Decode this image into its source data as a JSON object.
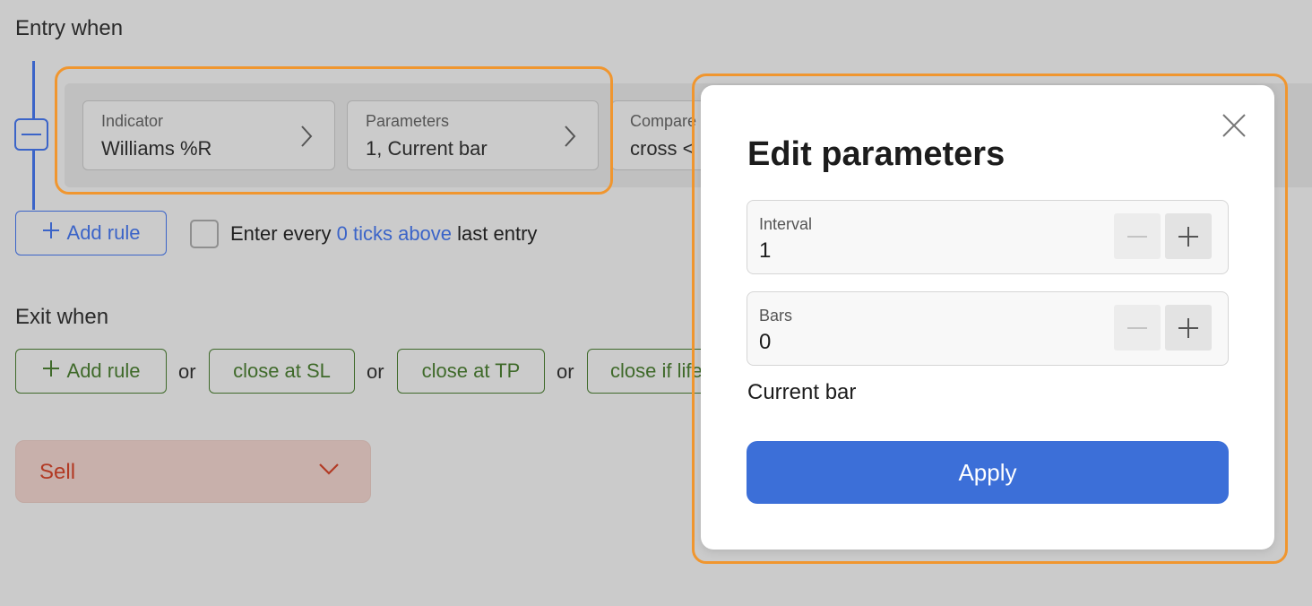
{
  "entry": {
    "title": "Entry when",
    "rule": {
      "indicator_label": "Indicator",
      "indicator_value": "Williams %R",
      "parameters_label": "Parameters",
      "parameters_value": "1, Current bar",
      "compare_label": "Compare",
      "compare_value": "cross <"
    },
    "add_rule": "Add rule",
    "checkbox": {
      "checked": false,
      "text_before": "Enter every",
      "link_text": "0 ticks above",
      "text_after": "last entry"
    }
  },
  "exit": {
    "title": "Exit when",
    "add_rule": "Add rule",
    "or_label": "or",
    "close_sl": "close at SL",
    "close_tp": "close at TP",
    "close_life": "close if life"
  },
  "action_select": {
    "value": "Sell"
  },
  "modal": {
    "title": "Edit parameters",
    "fields": [
      {
        "label": "Interval",
        "value": "1"
      },
      {
        "label": "Bars",
        "value": "0"
      }
    ],
    "bars_description": "Current bar",
    "apply": "Apply"
  },
  "colors": {
    "accent_blue": "#3b64c8",
    "apply_blue": "#3c6fd8",
    "exit_green": "#3f6a2a",
    "sell_red": "#b23a24",
    "highlight_orange": "#f0962f",
    "overlay_gray": "#cbcbcb"
  },
  "icons": {
    "rule_chevron": "chevron-right-icon",
    "select_chevron": "chevron-down-icon",
    "close": "close-icon",
    "decrement": "minus-icon",
    "increment": "plus-icon"
  }
}
